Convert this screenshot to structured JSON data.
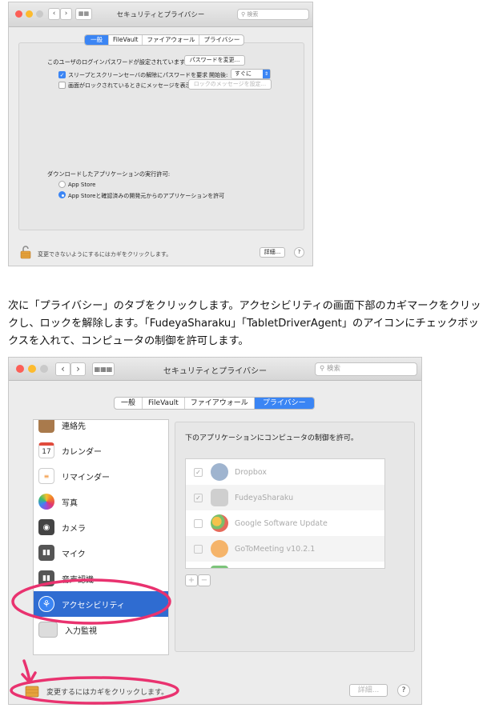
{
  "window1": {
    "title": "セキュリティとプライバシー",
    "search_placeholder": "検索",
    "tabs": [
      "一般",
      "FileVault",
      "ファイアウォール",
      "プライバシー"
    ],
    "general": {
      "login_password_label": "このユーザのログインパスワードが設定されています",
      "change_password_button": "パスワードを変更...",
      "require_password_label": "スリープとスクリーンセーバの解除にパスワードを要求",
      "start_after_label": "開始後:",
      "start_after_value": "すぐに",
      "lock_message_label": "画面がロックされているときにメッセージを表示",
      "set_lock_message_button": "ロックのメッセージを設定...",
      "download_heading": "ダウンロードしたアプリケーションの実行許可:",
      "radio_options": [
        "App Store",
        "App Storeと確認済みの開発元からのアプリケーションを許可"
      ]
    },
    "footer_text": "変更できないようにするにはカギをクリックします。",
    "advanced_button": "詳細...",
    "help": "?"
  },
  "instruction": {
    "text": "次に「プライバシー」のタブをクリックします。アクセシビリティの画面下部のカギマークをクリックし、ロックを解除します。「FudeyaSharaku」「TabletDriverAgent」のアイコンにチェックボックスを入れて、コンピュータの制御を許可します。"
  },
  "window2": {
    "title": "セキュリティとプライバシー",
    "search_placeholder": "検索",
    "tabs": [
      "一般",
      "FileVault",
      "ファイアウォール",
      "プライバシー"
    ],
    "sidebar_items": [
      {
        "label": "連絡先",
        "icon": "contacts-icon"
      },
      {
        "label": "カレンダー",
        "icon": "calendar-icon"
      },
      {
        "label": "リマインダー",
        "icon": "reminders-icon"
      },
      {
        "label": "写真",
        "icon": "photos-icon"
      },
      {
        "label": "カメラ",
        "icon": "camera-icon"
      },
      {
        "label": "マイク",
        "icon": "microphone-icon"
      },
      {
        "label": "音声認識",
        "icon": "speech-recognition-icon"
      },
      {
        "label": "アクセシビリティ",
        "icon": "accessibility-icon"
      },
      {
        "label": "入力監視",
        "icon": "keyboard-icon"
      }
    ],
    "calendar_day": "17",
    "selected_item": "アクセシビリティ",
    "allow_heading": "下のアプリケーションにコンピュータの制御を許可。",
    "apps": [
      {
        "name": "Dropbox",
        "checked": true,
        "color": "#8fa9c9"
      },
      {
        "name": "FudeyaSharaku",
        "checked": true,
        "color": "#c9c9c9"
      },
      {
        "name": "Google Software Update",
        "checked": false,
        "color": "#f0b64a"
      },
      {
        "name": "GoToMeeting v10.2.1",
        "checked": false,
        "color": "#f3a14e"
      }
    ],
    "add_button": "+",
    "remove_button": "−",
    "footer_text": "変更するにはカギをクリックします。",
    "advanced_button": "詳細...",
    "help": "?"
  },
  "colors": {
    "accent": "#3b85f4",
    "selection": "#2f6cd1",
    "annotation": "#e9326f"
  }
}
